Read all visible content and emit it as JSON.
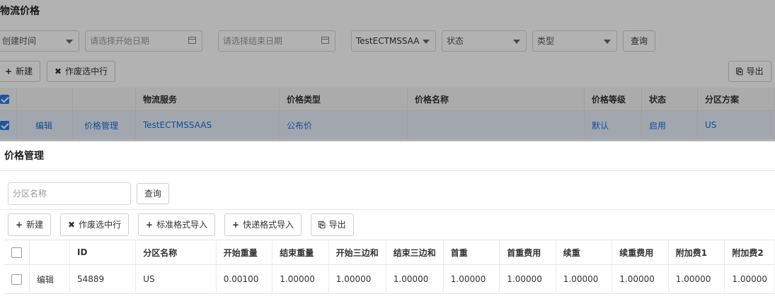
{
  "background": {
    "title": "物流价格",
    "filters": {
      "create_time": "创建时间",
      "start_date_placeholder": "请选择开始日期",
      "end_date_placeholder": "请选择结束日期",
      "customer": "TestECTMSSAA",
      "status": "状态",
      "type": "类型",
      "query": "查询"
    },
    "toolbar": {
      "new": "新建",
      "void": "作废选中行",
      "export": "导出"
    },
    "table": {
      "headers": [
        "物流服务",
        "价格类型",
        "价格名称",
        "价格等级",
        "状态",
        "分区方案"
      ],
      "row": {
        "edit": "编辑",
        "manage": "价格管理",
        "service": "TestECTMSSAAS",
        "price_type": "公布价",
        "price_name": "",
        "level": "默认",
        "status": "启用",
        "zone": "US"
      }
    }
  },
  "modal": {
    "title": "价格管理",
    "search_placeholder": "分区名称",
    "query": "查询",
    "toolbar": {
      "new": "新建",
      "void": "作废选中行",
      "std_import": "标准格式导入",
      "express_import": "快递格式导入",
      "export": "导出"
    },
    "table": {
      "headers": [
        "ID",
        "分区名称",
        "开始重量",
        "结束重量",
        "开始三边和",
        "结束三边和",
        "首重",
        "首重费用",
        "续重",
        "续重费用",
        "附加费1",
        "附加费2"
      ],
      "rows": [
        {
          "edit": "编辑",
          "cells": [
            "54889",
            "US",
            "0.00100",
            "1.00000",
            "1.00000",
            "1.00000",
            "1.00000",
            "1.00000",
            "1.00000",
            "1.00000",
            "1.00000",
            "1.00000"
          ]
        }
      ]
    }
  },
  "icons": {
    "new": "plus-icon",
    "void": "x-icon",
    "export": "export-icon",
    "calendar": "calendar-icon",
    "dropdown": "chevron-down-icon"
  }
}
